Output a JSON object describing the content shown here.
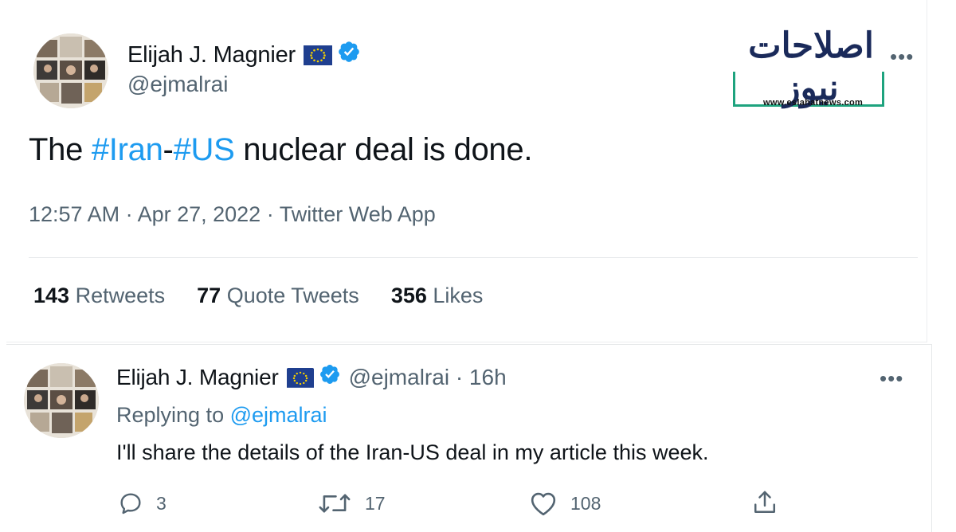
{
  "tweet": {
    "author": {
      "display_name": "Elijah J. Magnier",
      "handle": "@ejmalrai"
    },
    "text": {
      "prefix": "The ",
      "hashtag1": "#Iran",
      "dash": "-",
      "hashtag2": "#US",
      "suffix": " nuclear deal is done."
    },
    "meta": "12:57 AM · Apr 27, 2022 · Twitter Web App",
    "stats": [
      {
        "count": "143",
        "label": "Retweets"
      },
      {
        "count": "77",
        "label": "Quote Tweets"
      },
      {
        "count": "356",
        "label": "Likes"
      }
    ],
    "more_label": "•••"
  },
  "watermark": {
    "logo_text": "اصلاحات نیوز",
    "url": "www.eslahatnews.com"
  },
  "reply": {
    "author": {
      "display_name": "Elijah J. Magnier",
      "handle_time": "@ejmalrai · 16h"
    },
    "replying_prefix": "Replying to ",
    "replying_mention": "@ejmalrai",
    "text": "I'll share the details of the Iran-US deal in my article this week.",
    "more_label": "•••",
    "actions": {
      "replies": "3",
      "retweets": "17",
      "likes": "108"
    }
  },
  "icons": [
    "eu-flag-icon",
    "verified-badge-icon",
    "reply-icon",
    "retweet-icon",
    "like-icon",
    "share-icon",
    "more-icon"
  ],
  "colors": {
    "link": "#1d9bf0",
    "secondary_text": "#536471",
    "verified": "#1d9bf0",
    "eu_flag": "#1f3f8f",
    "logo_frame": "#1ea37e"
  }
}
